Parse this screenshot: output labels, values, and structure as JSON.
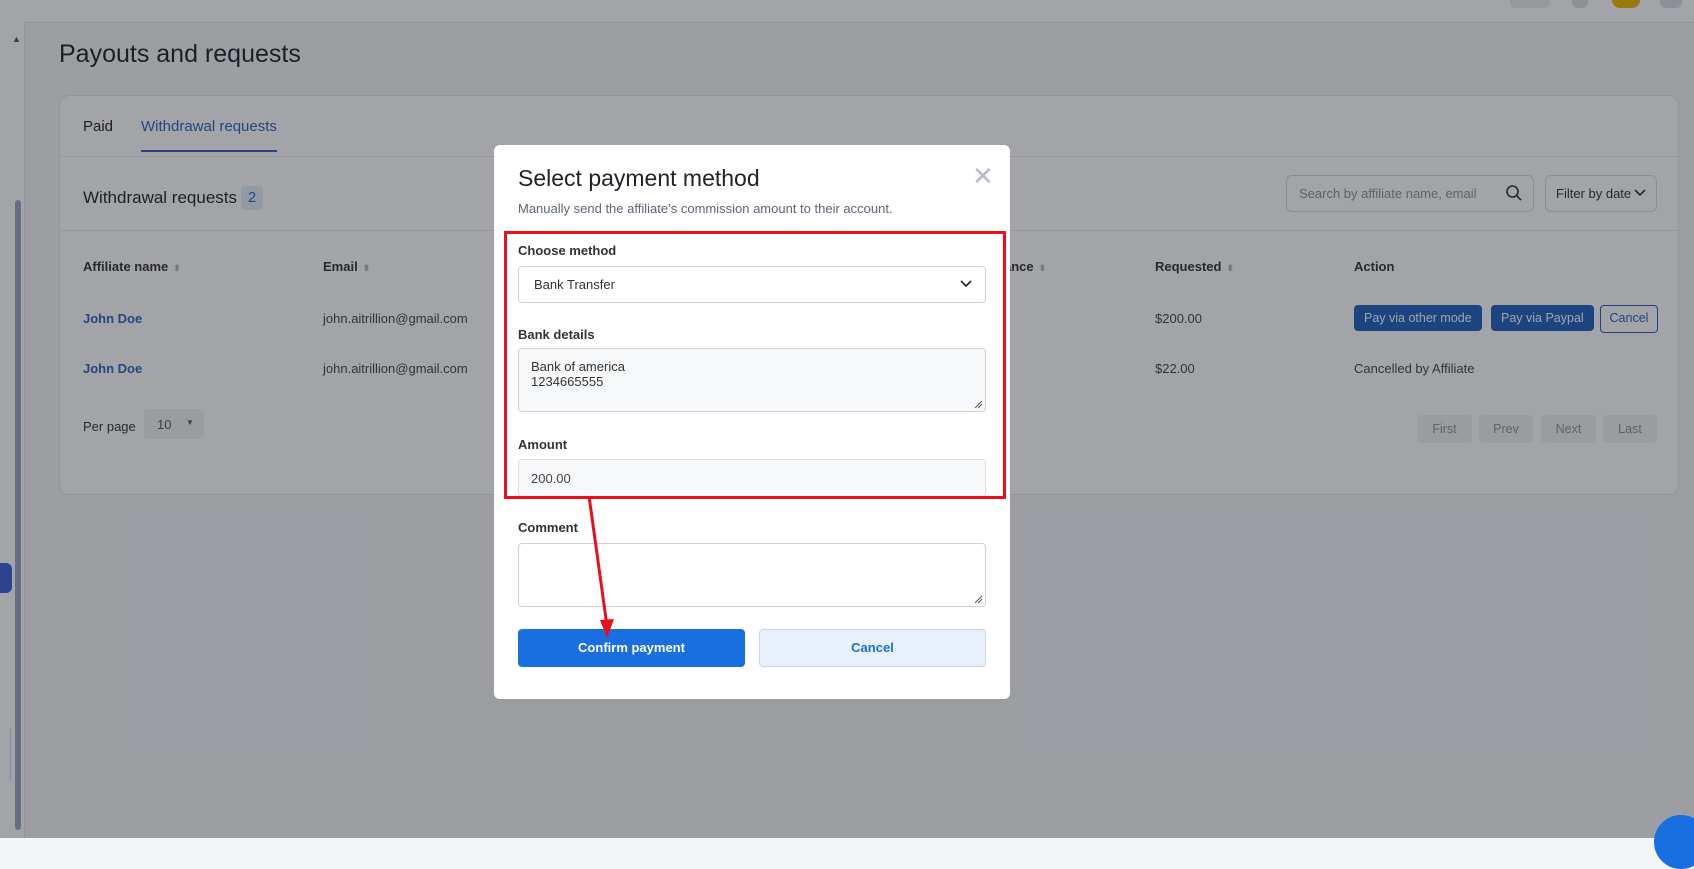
{
  "page": {
    "title": "Payouts and requests"
  },
  "tabs": [
    {
      "label": "Paid"
    },
    {
      "label": "Withdrawal requests"
    }
  ],
  "section": {
    "title": "Withdrawal requests",
    "count": "2"
  },
  "search": {
    "placeholder": "Search by affiliate name, email"
  },
  "filter": {
    "label": "Filter by date"
  },
  "table": {
    "headers": {
      "affiliate": "Affiliate name",
      "email": "Email",
      "balance": "ance",
      "requested": "Requested",
      "action": "Action"
    },
    "rows": [
      {
        "name": "John Doe",
        "email": "john.aitrillion@gmail.com",
        "requested": "$200.00",
        "actions": {
          "other_mode": "Pay via other mode",
          "paypal": "Pay via Paypal",
          "cancel": "Cancel"
        }
      },
      {
        "name": "John Doe",
        "email": "john.aitrillion@gmail.com",
        "requested": "$22.00",
        "status": "Cancelled by Affiliate"
      }
    ]
  },
  "pagination": {
    "per_page_label": "Per page",
    "per_page_value": "10",
    "buttons": [
      "First",
      "Prev",
      "Next",
      "Last"
    ]
  },
  "modal": {
    "title": "Select payment method",
    "subtitle": "Manually send the affiliate’s commission amount to their account.",
    "choose_method_label": "Choose method",
    "choose_method_value": "Bank Transfer",
    "bank_details_label": "Bank details",
    "bank_details_lines": [
      "Bank of america",
      "1234665555"
    ],
    "amount_label": "Amount",
    "amount_value": "200.00",
    "comment_label": "Comment",
    "confirm_label": "Confirm payment",
    "cancel_label": "Cancel"
  },
  "colors": {
    "accent": "#1a6fe0",
    "table_action": "#1e5fbf",
    "annotation": "#e8101c"
  },
  "icons": [
    "search-icon",
    "chevron-down-icon",
    "close-icon",
    "resize-grip-icon",
    "sort-icon"
  ]
}
